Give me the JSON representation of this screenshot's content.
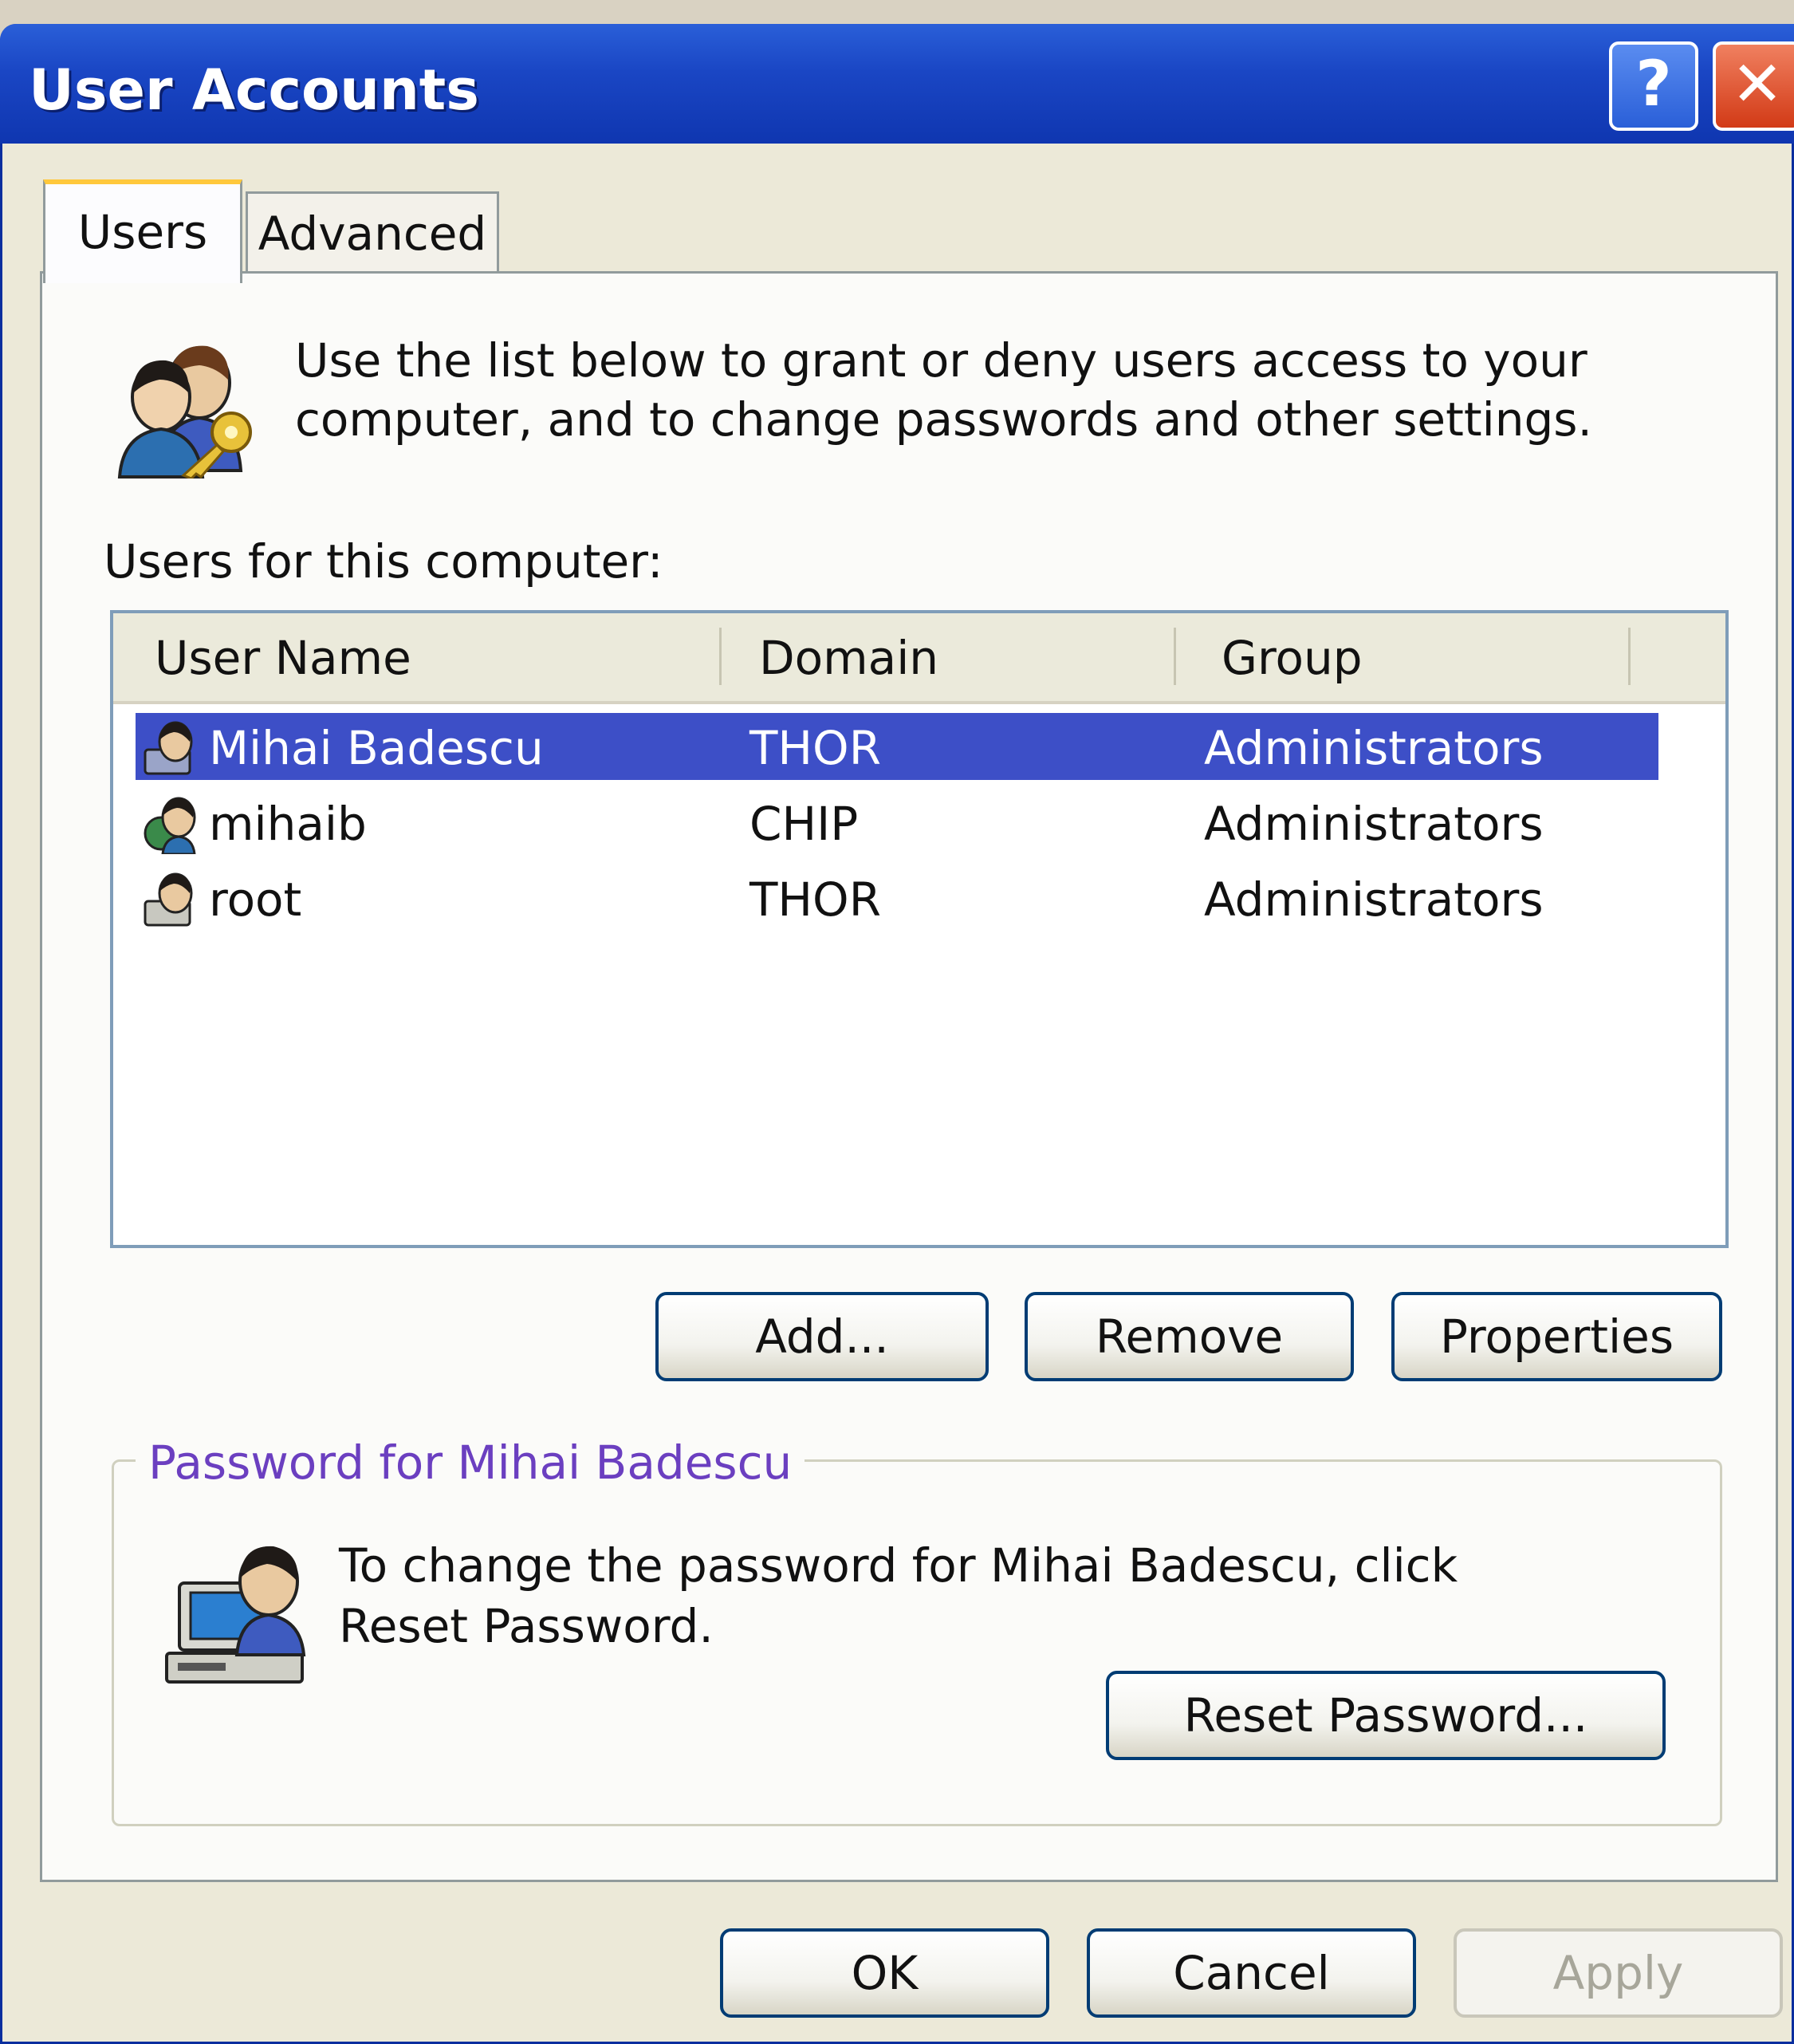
{
  "window": {
    "title": "User Accounts"
  },
  "titlebar_buttons": {
    "help": "?",
    "close": "✕"
  },
  "tabs": [
    {
      "label": "Users",
      "active": true
    },
    {
      "label": "Advanced",
      "active": false
    }
  ],
  "intro_text": "Use the list below to grant or deny users access to your computer, and to change passwords and other settings.",
  "users_list": {
    "label": "Users for this computer:",
    "columns": [
      "User Name",
      "Domain",
      "Group"
    ],
    "rows": [
      {
        "name": "Mihai Badescu",
        "domain": "THOR",
        "group": "Administrators",
        "selected": true
      },
      {
        "name": "mihaib",
        "domain": "CHIP",
        "group": "Administrators",
        "selected": false
      },
      {
        "name": "root",
        "domain": "THOR",
        "group": "Administrators",
        "selected": false
      }
    ]
  },
  "list_buttons": {
    "add": "Add...",
    "remove": "Remove",
    "properties": "Properties"
  },
  "password_group": {
    "title": "Password for Mihai Badescu",
    "text": "To change the password for Mihai Badescu, click Reset Password.",
    "reset_button": "Reset Password..."
  },
  "dialog_buttons": {
    "ok": "OK",
    "cancel": "Cancel",
    "apply": "Apply"
  },
  "colors": {
    "title_bar": "#1a46c4",
    "selection": "#3d4fc7",
    "group_title": "#6b3fc0"
  },
  "icons": [
    "users-key-icon",
    "user-icon",
    "computer-user-icon",
    "help-icon",
    "close-icon"
  ]
}
